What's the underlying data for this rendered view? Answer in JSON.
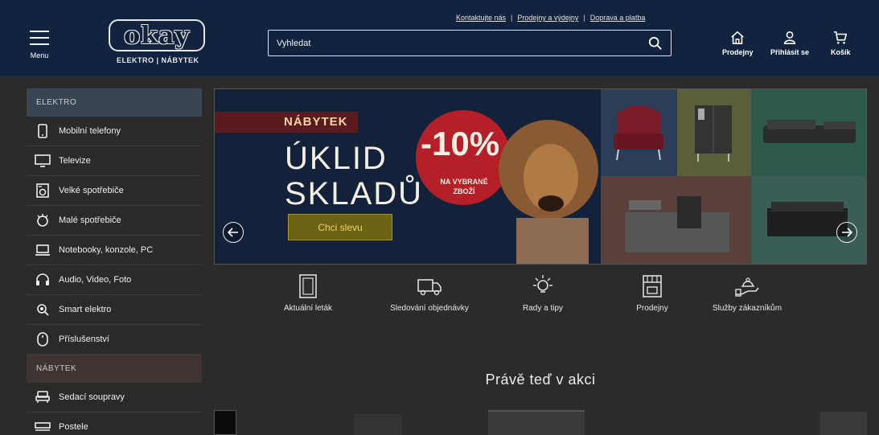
{
  "header": {
    "top_links": [
      "Kontaktujte nás",
      "Prodejny a výdejny",
      "Doprava a platba"
    ],
    "top_sep": "|",
    "menu_label": "Menu",
    "logo_text": "okay",
    "logo_sub": "ELEKTRO | NÁBYTEK",
    "search_placeholder": "Vyhledat",
    "actions": [
      {
        "label": "Prodejny",
        "icon": "store-icon"
      },
      {
        "label": "Přihlásit se",
        "icon": "user-icon"
      },
      {
        "label": "Košík",
        "icon": "cart-icon"
      }
    ]
  },
  "sidebar": {
    "elektro_heading": "ELEKTRO",
    "elektro_items": [
      {
        "label": "Mobilní telefony",
        "icon": "phone-icon"
      },
      {
        "label": "Televize",
        "icon": "tv-icon"
      },
      {
        "label": "Velké spotřebiče",
        "icon": "washer-icon"
      },
      {
        "label": "Malé spotřebiče",
        "icon": "appliance-icon"
      },
      {
        "label": "Notebooky, konzole, PC",
        "icon": "laptop-icon"
      },
      {
        "label": "Audio, Video, Foto",
        "icon": "headphones-icon"
      },
      {
        "label": "Smart elektro",
        "icon": "smart-icon"
      },
      {
        "label": "Příslušenství",
        "icon": "mouse-icon"
      }
    ],
    "nabytek_heading": "NÁBYTEK",
    "nabytek_items": [
      {
        "label": "Sedací soupravy",
        "icon": "sofa-icon"
      },
      {
        "label": "Postele",
        "icon": "bed-icon"
      }
    ]
  },
  "banner": {
    "tag": "NÁBYTEK",
    "title_line1": "ÚKLID",
    "title_line2": "SKLADŮ",
    "discount": "-10%",
    "discount_sub1": "NA VYBRANÉ",
    "discount_sub2": "ZBOŽÍ",
    "cta": "Chci slevu"
  },
  "quick_links": [
    {
      "label": "Aktuální leták",
      "icon": "flyer-icon"
    },
    {
      "label": "Sledování objednávky",
      "icon": "truck-icon"
    },
    {
      "label": "Rady a tipy",
      "icon": "bulb-icon"
    },
    {
      "label": "Prodejny",
      "icon": "shop-icon"
    },
    {
      "label": "Služby zákazníkům",
      "icon": "service-icon"
    }
  ],
  "section_title": "Právě teď v akci",
  "colors": {
    "header_bg": "#12233f",
    "page_bg": "#2b2b2b",
    "sidebar_elektro": "#394553",
    "sidebar_nabytek": "#3f3432",
    "banner_red": "#b51f28",
    "cta_bg": "#6b6213"
  }
}
